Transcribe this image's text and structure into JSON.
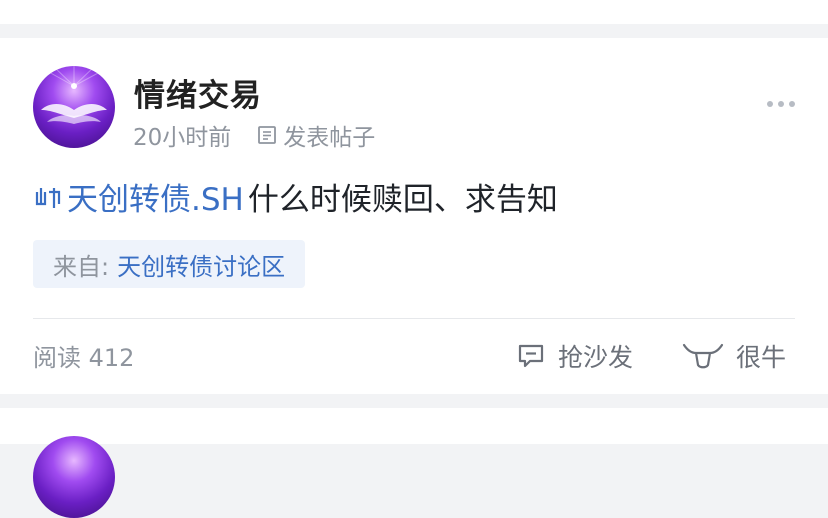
{
  "post": {
    "author": "情绪交易",
    "time": "20小时前",
    "action_type": "发表帖子",
    "stock_name": "天创转债.SH",
    "title_text": "什么时候赎回、求告知",
    "source_label": "来自:",
    "source_name": "天创转债讨论区",
    "reads": "阅读 412",
    "comment_label": "抢沙发",
    "like_label": "很牛"
  },
  "icons": {
    "avatar": "avatar-purple-wings",
    "doc": "document-icon",
    "bond": "bond-icon",
    "more": "more-dots-icon",
    "comment": "comment-icon",
    "like": "bull-icon"
  },
  "colors": {
    "link": "#3a6fc4",
    "meta": "#8f959e",
    "tag_bg": "#eef3fb",
    "page_bg": "#f2f3f5"
  }
}
